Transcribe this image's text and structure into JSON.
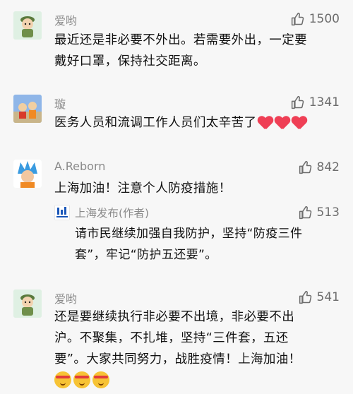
{
  "comments": [
    {
      "username": "爱哟",
      "likes": "1500",
      "text_lines": [
        "最近还是非必要不外出。若需要外出，一定要",
        "戴好口罩，保持社交距离。"
      ]
    },
    {
      "username": "璇",
      "likes": "1341",
      "text": "医务人员和流调工作人员们太辛苦了",
      "emojis": [
        "heart",
        "heart",
        "heart"
      ]
    },
    {
      "username": "A.Reborn",
      "likes": "842",
      "text": "上海加油！注意个人防疫措施！",
      "reply": {
        "username": "上海发布(作者)",
        "likes": "513",
        "text_lines": [
          "请市民继续加强自我防护，坚持“防疫三件",
          "套”，牢记“防护五还要”。"
        ]
      }
    },
    {
      "username": "爱哟",
      "likes": "541",
      "text_lines": [
        "还是要继续执行非必要不出境，非必要不出",
        "沪。不聚集，不扎堆，坚持“三件套，五还",
        "要”。大家共同努力，战胜疫情！上海加油！"
      ],
      "emojis": [
        "fighting-face",
        "fighting-face",
        "fighting-face"
      ]
    }
  ],
  "colors": {
    "background": "#f7f7f7",
    "username": "#8a8a8a",
    "text": "#111111",
    "like": "#6d6d6d",
    "heart": "#ef3f55"
  },
  "icons": {
    "like": "thumbs-up-icon",
    "avatars": [
      "cartoon-soldier-avatar",
      "kids-avatar",
      "anime-goku-avatar",
      "shanghai-fabu-logo",
      "cartoon-soldier-avatar"
    ]
  }
}
